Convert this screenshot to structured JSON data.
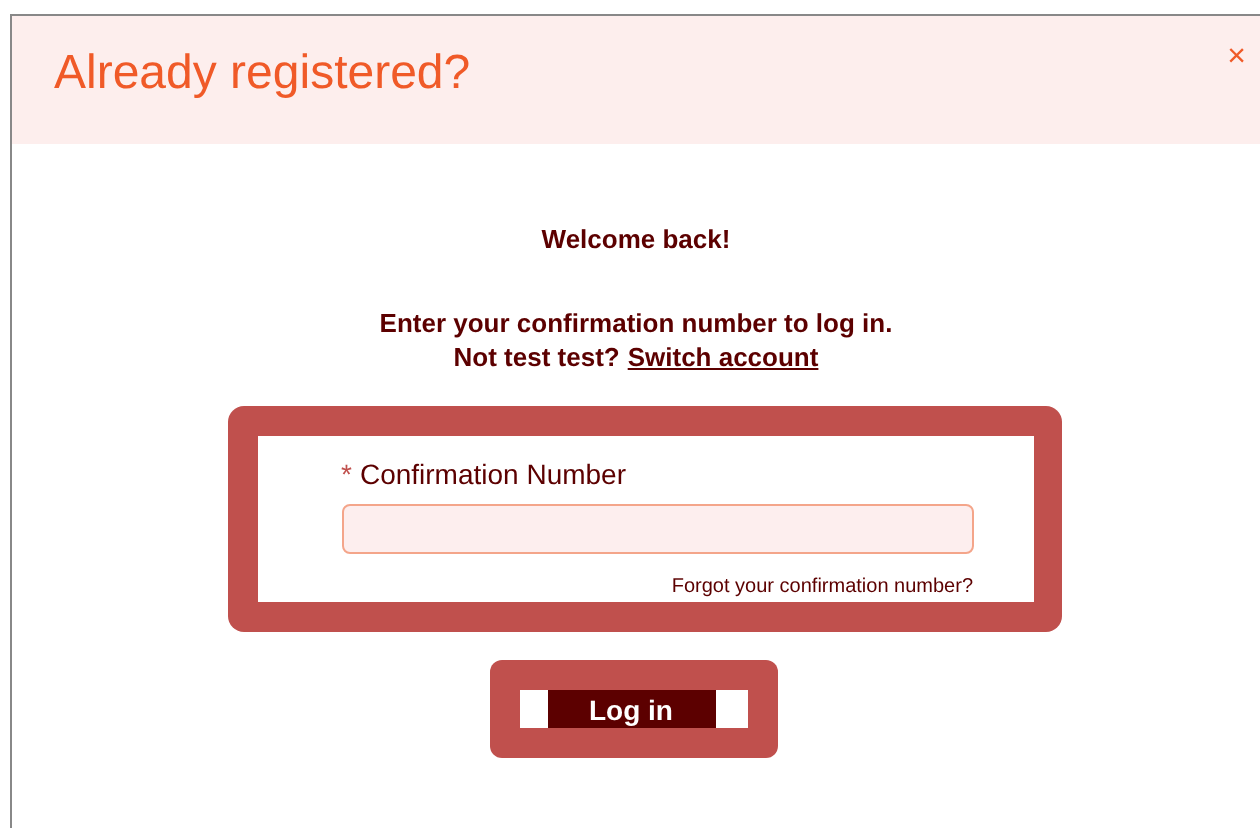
{
  "dialog": {
    "title": "Already registered?",
    "close": "×"
  },
  "welcome": "Welcome back!",
  "instructions": "Enter your confirmation number to log in.",
  "not_user": {
    "text": "Not test test?",
    "link": "Switch account"
  },
  "form": {
    "required_mark": "*",
    "label": "Confirmation Number",
    "forgot_link": "Forgot your confirmation number?"
  },
  "login_button": "Log in"
}
